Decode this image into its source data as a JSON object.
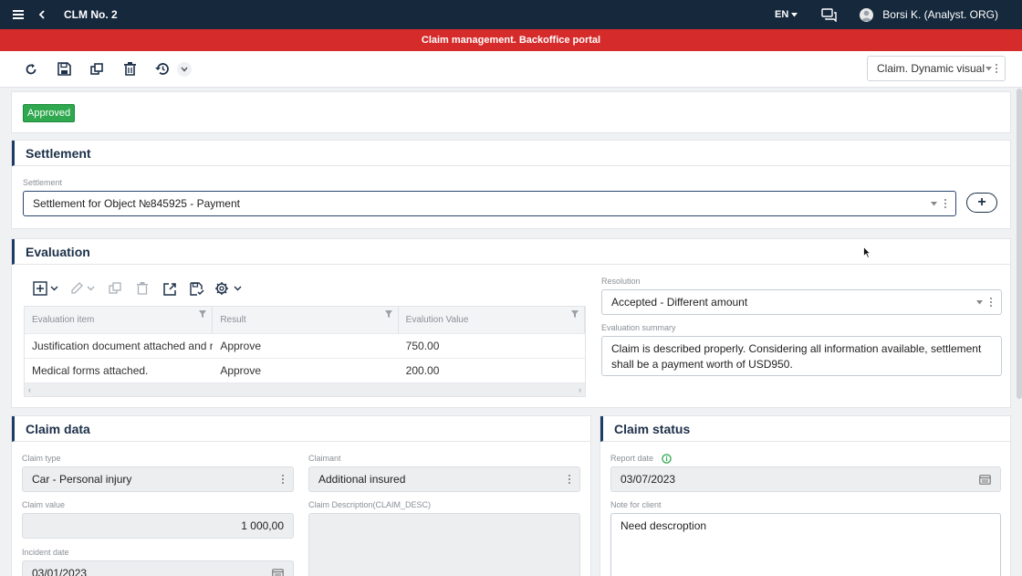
{
  "topbar": {
    "title": "CLM No. 2",
    "lang": "EN",
    "user": "Borsi K. (Analyst. ORG)"
  },
  "banner": {
    "text": "Claim management. Backoffice portal"
  },
  "toolbar": {
    "view_select": "Claim. Dynamic visual"
  },
  "status": {
    "badge": "Approved"
  },
  "settlement": {
    "title": "Settlement",
    "field_label": "Settlement",
    "value": "Settlement for Object №845925 - Payment",
    "add_label": "+"
  },
  "evaluation": {
    "title": "Evaluation",
    "columns": [
      "Evaluation item",
      "Result",
      "Evalution Value"
    ],
    "rows": [
      {
        "item": "Justification document attached and relevant",
        "result": "Approve",
        "value": "750.00"
      },
      {
        "item": "Medical forms attached.",
        "result": "Approve",
        "value": "200.00"
      }
    ],
    "resolution_label": "Resolution",
    "resolution_value": "Accepted - Different amount",
    "summary_label": "Evaluation summary",
    "summary_value": "Claim is described properly. Considering all information available, settlement shall be a payment worth of USD950."
  },
  "claim_data": {
    "title": "Claim data",
    "claim_type_label": "Claim type",
    "claim_type_value": "Car - Personal injury",
    "claimant_label": "Claimant",
    "claimant_value": "Additional insured",
    "claim_value_label": "Claim value",
    "claim_value": "1 000,00",
    "claim_desc_label": "Claim Description(CLAIM_DESC)",
    "incident_date_label": "Incident date",
    "incident_date_value": "03/01/2023"
  },
  "claim_status": {
    "title": "Claim status",
    "report_date_label": "Report date",
    "report_date_value": "03/07/2023",
    "note_label": "Note for client",
    "note_value": "Need descroption"
  },
  "colors": {
    "topbar": "#15283c",
    "banner": "#d62b2b",
    "badge": "#2fa84f",
    "accent": "#1d3d66"
  }
}
